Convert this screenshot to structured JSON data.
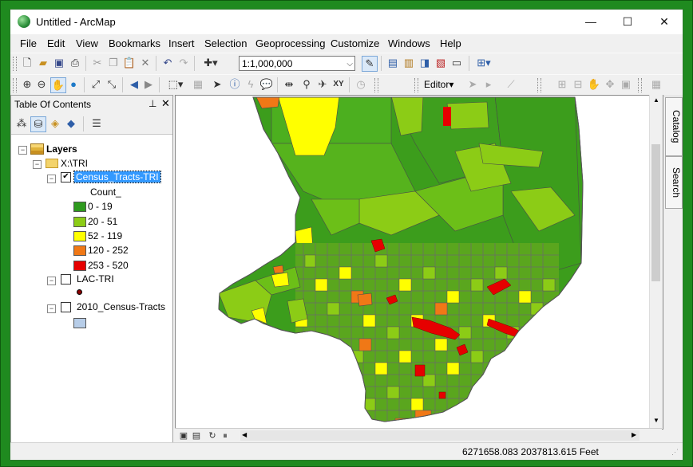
{
  "window": {
    "title": "Untitled - ArcMap",
    "controls": [
      "—",
      "☐",
      "✕"
    ]
  },
  "menu": [
    "File",
    "Edit",
    "View",
    "Bookmarks",
    "Insert",
    "Selection",
    "Geoprocessing",
    "Customize",
    "Windows",
    "Help"
  ],
  "toolbar": {
    "scale": "1:1,000,000",
    "editor_label": "Editor▾"
  },
  "toc": {
    "title": "Table Of Contents",
    "root": "Layers",
    "folder": "X:\\TRI",
    "layer1": {
      "name": "Census_Tracts-TRI",
      "field": "Count_",
      "checked": true
    },
    "legend": [
      {
        "label": "0 - 19",
        "color": "#2e9a1e"
      },
      {
        "label": "20 - 51",
        "color": "#8ccc16"
      },
      {
        "label": "52 - 119",
        "color": "#ffff00"
      },
      {
        "label": "120 - 252",
        "color": "#f07816"
      },
      {
        "label": "253 - 520",
        "color": "#e60000"
      }
    ],
    "layer2": {
      "name": "LAC-TRI",
      "checked": false
    },
    "layer3": {
      "name": "2010_Census-Tracts",
      "checked": false,
      "color": "#b7cde8"
    }
  },
  "side_tabs": [
    "Catalog",
    "Search"
  ],
  "status": {
    "coordinates": "6271658.083  2037813.615 Feet"
  }
}
